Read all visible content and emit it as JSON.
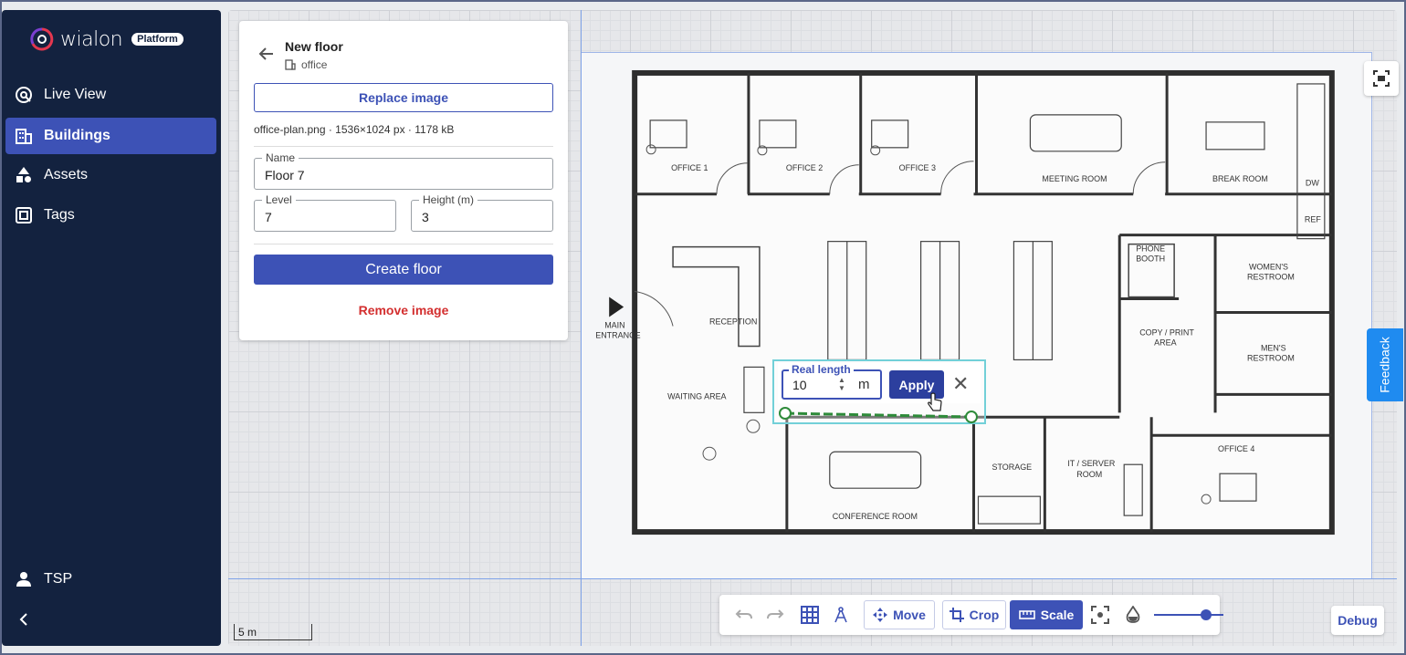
{
  "app": {
    "logo_text": "wialon",
    "logo_badge": "Platform"
  },
  "sidebar": {
    "items": [
      {
        "label": "Live View",
        "icon": "live-view-icon",
        "active": false
      },
      {
        "label": "Buildings",
        "icon": "buildings-icon",
        "active": true
      },
      {
        "label": "Assets",
        "icon": "assets-icon",
        "active": false
      },
      {
        "label": "Tags",
        "icon": "tags-icon",
        "active": false
      }
    ],
    "user_label": "TSP",
    "collapse_icon": "chevron-left-icon"
  },
  "panel": {
    "title": "New floor",
    "building": "office",
    "replace_label": "Replace image",
    "file_info": "office-plan.png · 1536×1024 px · 1178 kB",
    "name_label": "Name",
    "name_value": "Floor 7",
    "level_label": "Level",
    "level_value": "7",
    "height_label": "Height (m)",
    "height_value": "3",
    "create_label": "Create floor",
    "remove_label": "Remove image"
  },
  "plan": {
    "rooms": {
      "office1": "OFFICE 1",
      "office2": "OFFICE 2",
      "office3": "OFFICE 3",
      "meeting": "MEETING ROOM",
      "break": "BREAK ROOM",
      "phone1": "PHONE",
      "phone2": "BOOTH",
      "womens1": "WOMEN'S",
      "womens2": "RESTROOM",
      "mens1": "MEN'S",
      "mens2": "RESTROOM",
      "copy1": "COPY / PRINT",
      "copy2": "AREA",
      "reception": "RECEPTION",
      "main1": "MAIN",
      "main2": "ENTRANCE",
      "waiting": "WAITING AREA",
      "conference": "CONFERENCE ROOM",
      "storage": "STORAGE",
      "it1": "IT / SERVER",
      "it2": "ROOM",
      "office4": "OFFICE 4",
      "dw": "DW",
      "ref": "REF"
    }
  },
  "scale_popup": {
    "label": "Real length",
    "value": "10",
    "unit": "m",
    "apply_label": "Apply"
  },
  "toolbar": {
    "move_label": "Move",
    "crop_label": "Crop",
    "scale_label": "Scale",
    "opacity": 0.75
  },
  "feedback_label": "Feedback",
  "debug_label": "Debug",
  "scalebar_label": "5 m",
  "colors": {
    "sidebar_bg": "#13223f",
    "accent": "#3d52b6",
    "danger": "#d32f2f",
    "feedback": "#1f8bf0",
    "scale_line": "#2e8b3a"
  }
}
